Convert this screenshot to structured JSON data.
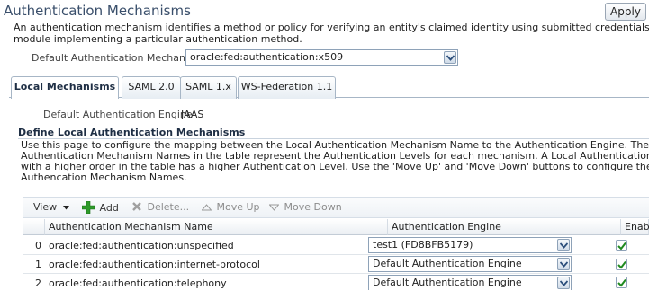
{
  "page": {
    "title": "Authentication Mechanisms",
    "apply_label": "Apply",
    "description_line1": "An authentication mechanism identifies a method or policy for verifying an entity's claimed identity using submitted credentials. An authentication en",
    "description_line2": "module implementing a particular authentication method."
  },
  "default_mechanism": {
    "label": "Default Authentication Mechanism",
    "value": "oracle:fed:authentication:x509"
  },
  "tabs": [
    {
      "label": "Local Mechanisms",
      "active": true
    },
    {
      "label": "SAML 2.0",
      "active": false
    },
    {
      "label": "SAML 1.x",
      "active": false
    },
    {
      "label": "WS-Federation 1.1",
      "active": false
    }
  ],
  "engine": {
    "label": "Default Authentication Engine",
    "value": "JAAS"
  },
  "section": {
    "title": "Define Local Authentication Mechanisms",
    "lines": [
      "Use this page to configure the mapping between the Local Authentication Mechanism Name to the Authentication Engine. The order of the Local",
      "Authentication Mechanism Names in the table represent the Authentication Levels for each mechanism. A Local Authentication Mechanism Name",
      "with a higher order in the table has a higher Authentication Level. Use the 'Move Up' and 'Move Down' buttons to configure the orders of the Loca",
      "Authencation Mechanism Names."
    ]
  },
  "toolbar": {
    "view_label": "View",
    "add_label": "Add",
    "delete_label": "Delete...",
    "moveup_label": "Move Up",
    "movedown_label": "Move Down"
  },
  "table": {
    "columns": [
      "Authentication Mechanism Name",
      "Authentication Engine",
      "Enabled"
    ],
    "rows": [
      {
        "index": "0",
        "name": "oracle:fed:authentication:unspecified",
        "engine": "test1 (FD8BFB5179)",
        "enabled": true
      },
      {
        "index": "1",
        "name": "oracle:fed:authentication:internet-protocol",
        "engine": "Default Authentication Engine",
        "enabled": true
      },
      {
        "index": "2",
        "name": "oracle:fed:authentication:telephony",
        "engine": "Default Authentication Engine",
        "enabled": true
      }
    ]
  },
  "colors": {
    "title": "#3a4f6b",
    "accent_border": "#a7b6c6",
    "add_icon_green": "#2e9a2a",
    "checkmark_green": "#1f8a1f"
  }
}
